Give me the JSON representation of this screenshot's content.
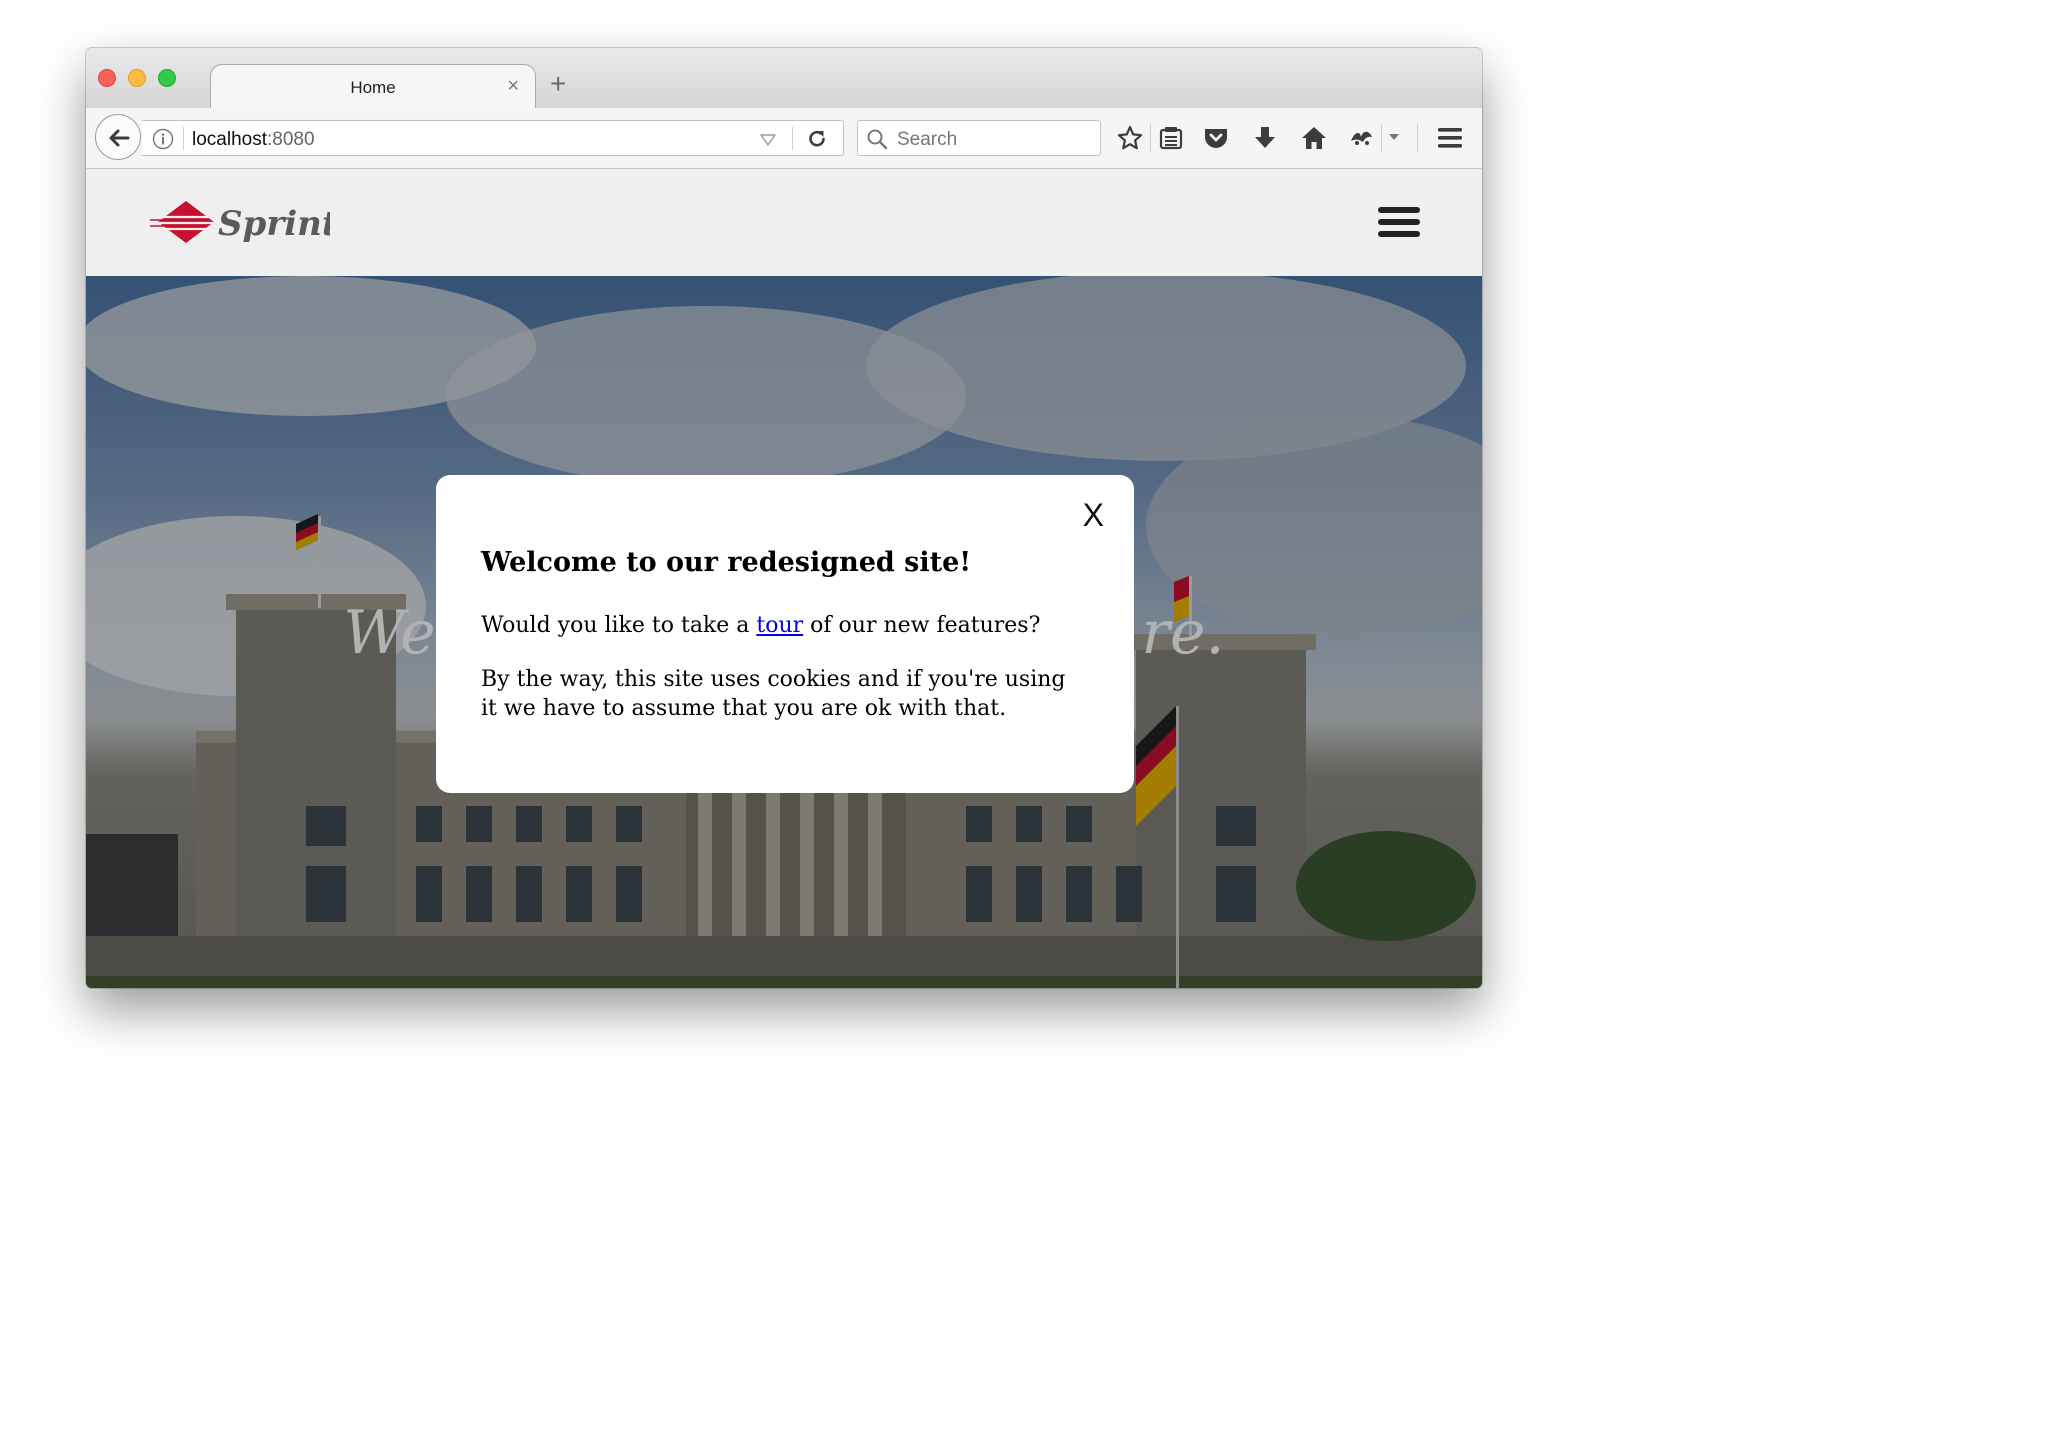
{
  "browser": {
    "tab": {
      "title": "Home",
      "close_glyph": "×"
    },
    "new_tab_glyph": "+",
    "address": {
      "host": "localhost",
      "port": ":8080"
    },
    "search": {
      "placeholder": "Search"
    },
    "toolbar_icons": [
      "back-arrow-icon",
      "info-icon",
      "dropdown-icon",
      "reload-icon",
      "search-icon",
      "bookmark-star-icon",
      "reading-list-icon",
      "pocket-icon",
      "download-icon",
      "home-icon",
      "extension-icon",
      "extension-dropdown-icon",
      "menu-icon"
    ]
  },
  "site": {
    "logo_text": "Sprint",
    "brand_color": "#c8102e",
    "hero_heading": "We                                     re."
  },
  "modal": {
    "close_label": "X",
    "title": "Welcome to our redesigned site!",
    "p1_before": "Would you like to take a ",
    "p1_link": "tour",
    "p1_after": " of our new features?",
    "p2": "By the way, this site uses cookies and if you're using it we have to assume that you are ok with that."
  }
}
